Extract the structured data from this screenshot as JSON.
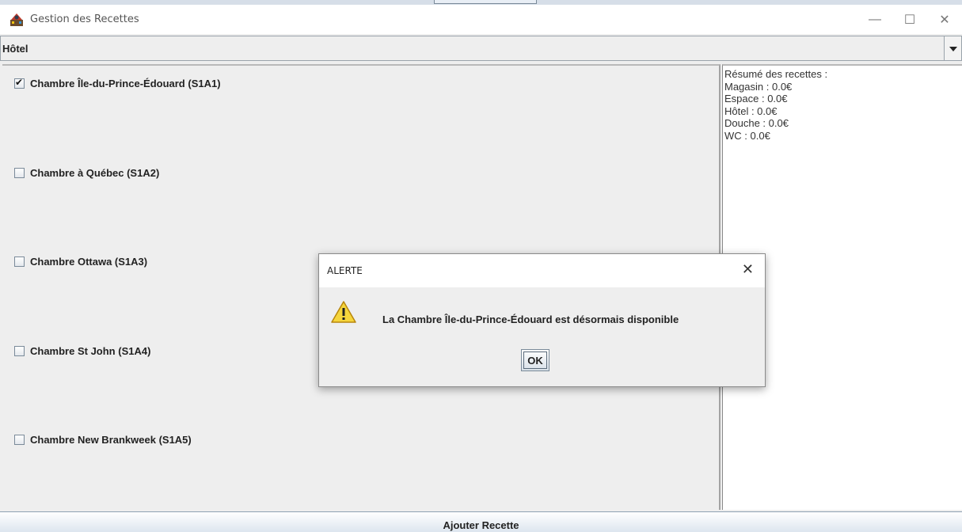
{
  "window": {
    "title": "Gestion des Recettes",
    "controls": {
      "minimize": "—",
      "maximize": "☐",
      "close": "✕"
    }
  },
  "category_select": {
    "selected": "Hôtel"
  },
  "rooms": [
    {
      "label": "Chambre Île-du-Prince-Édouard (S1A1)",
      "checked": true
    },
    {
      "label": "Chambre à Québec (S1A2)",
      "checked": false
    },
    {
      "label": "Chambre Ottawa (S1A3)",
      "checked": false
    },
    {
      "label": "Chambre St John (S1A4)",
      "checked": false
    },
    {
      "label": "Chambre New Brankweek (S1A5)",
      "checked": false
    }
  ],
  "summary": {
    "heading": "Résumé des recettes :",
    "lines": [
      "Magasin : 0.0€",
      "Espace : 0.0€",
      "Hôtel : 0.0€",
      "Douche : 0.0€",
      "WC : 0.0€"
    ]
  },
  "add_button": {
    "label": "Ajouter Recette"
  },
  "dialog": {
    "title": "ALERTE",
    "close": "✕",
    "message": "La Chambre Île-du-Prince-Édouard est désormais disponible",
    "ok_label": "OK",
    "icon": "warning-icon"
  },
  "colors": {
    "warning_fill": "#f5d53c",
    "warning_stroke": "#b8860b",
    "panel_bg": "#eeeeee"
  }
}
